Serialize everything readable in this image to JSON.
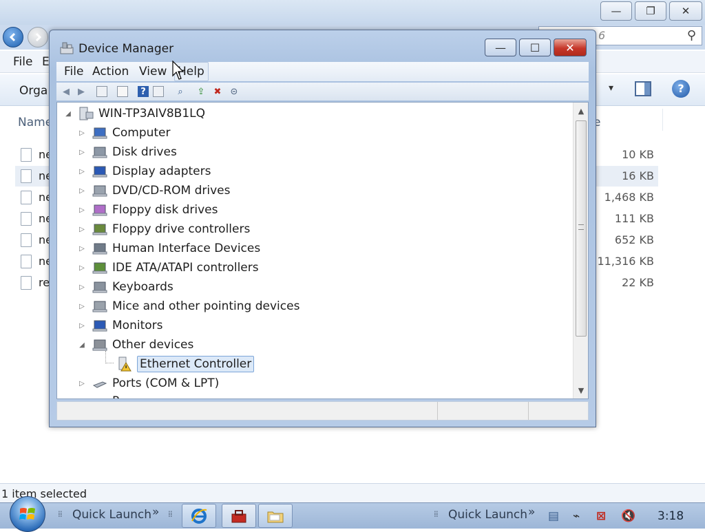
{
  "explorer": {
    "window_buttons": {
      "minimize": "—",
      "maximize": "❐",
      "close": "✕"
    },
    "search_placeholder": "6",
    "menu": {
      "file": "File",
      "edit": "E"
    },
    "toolbar": {
      "organize": "Orga"
    },
    "columns": {
      "name": "Name",
      "size": "e"
    },
    "files": [
      {
        "name": "ne",
        "size": "10 KB"
      },
      {
        "name": "ne",
        "size": "16 KB"
      },
      {
        "name": "ne",
        "size": "1,468 KB"
      },
      {
        "name": "ne",
        "size": "111 KB"
      },
      {
        "name": "ne",
        "size": "652 KB"
      },
      {
        "name": "ne",
        "size": "11,316 KB"
      },
      {
        "name": "re",
        "size": "22 KB"
      }
    ],
    "status": "1 item selected"
  },
  "device_manager": {
    "title": "Device Manager",
    "buttons": {
      "minimize": "—",
      "maximize": "☐",
      "close": "✕"
    },
    "menu": {
      "file": "File",
      "action": "Action",
      "view": "View",
      "help": "Help"
    },
    "root": "WIN-TP3AIV8B1LQ",
    "categories": [
      "Computer",
      "Disk drives",
      "Display adapters",
      "DVD/CD-ROM drives",
      "Floppy disk drives",
      "Floppy drive controllers",
      "Human Interface Devices",
      "IDE ATA/ATAPI controllers",
      "Keyboards",
      "Mice and other pointing devices",
      "Monitors",
      "Other devices"
    ],
    "other_devices_child": "Ethernet Controller",
    "after": "Ports (COM & LPT)",
    "partial": "P"
  },
  "taskbar": {
    "quick_launch_1": "Quick Launch",
    "quick_launch_2": "Quick Launch",
    "chevron": "»",
    "clock": "3:18"
  }
}
